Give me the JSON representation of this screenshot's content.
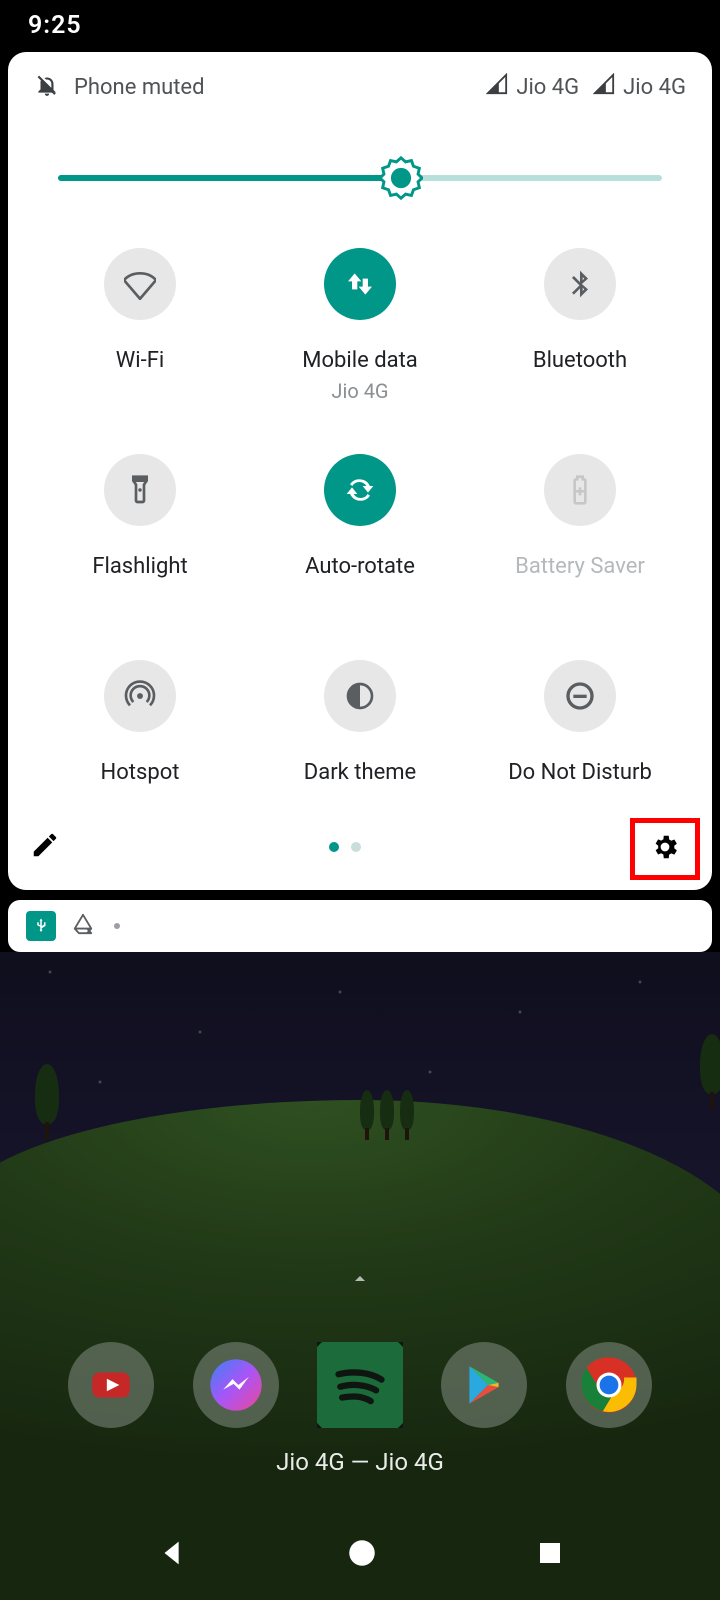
{
  "status": {
    "time": "9:25"
  },
  "header": {
    "status_text": "Phone muted",
    "sim1": "Jio 4G",
    "sim2": "Jio 4G"
  },
  "brightness": {
    "percent": 52
  },
  "tiles": [
    {
      "id": "wifi",
      "label": "Wi-Fi",
      "sub": "",
      "state": "off"
    },
    {
      "id": "mobile_data",
      "label": "Mobile data",
      "sub": "Jio 4G",
      "state": "on"
    },
    {
      "id": "bluetooth",
      "label": "Bluetooth",
      "sub": "",
      "state": "off"
    },
    {
      "id": "flashlight",
      "label": "Flashlight",
      "sub": "",
      "state": "off"
    },
    {
      "id": "auto_rotate",
      "label": "Auto-rotate",
      "sub": "",
      "state": "on"
    },
    {
      "id": "battery_saver",
      "label": "Battery Saver",
      "sub": "",
      "state": "disabled"
    },
    {
      "id": "hotspot",
      "label": "Hotspot",
      "sub": "",
      "state": "off"
    },
    {
      "id": "dark_theme",
      "label": "Dark theme",
      "sub": "",
      "state": "off"
    },
    {
      "id": "dnd",
      "label": "Do Not Disturb",
      "sub": "",
      "state": "off"
    }
  ],
  "pager": {
    "active": 0,
    "pages": 2
  },
  "carrier": {
    "line": "Jio 4G — Jio 4G"
  },
  "colors": {
    "accent": "#009688",
    "highlight_box": "#ff0000"
  }
}
